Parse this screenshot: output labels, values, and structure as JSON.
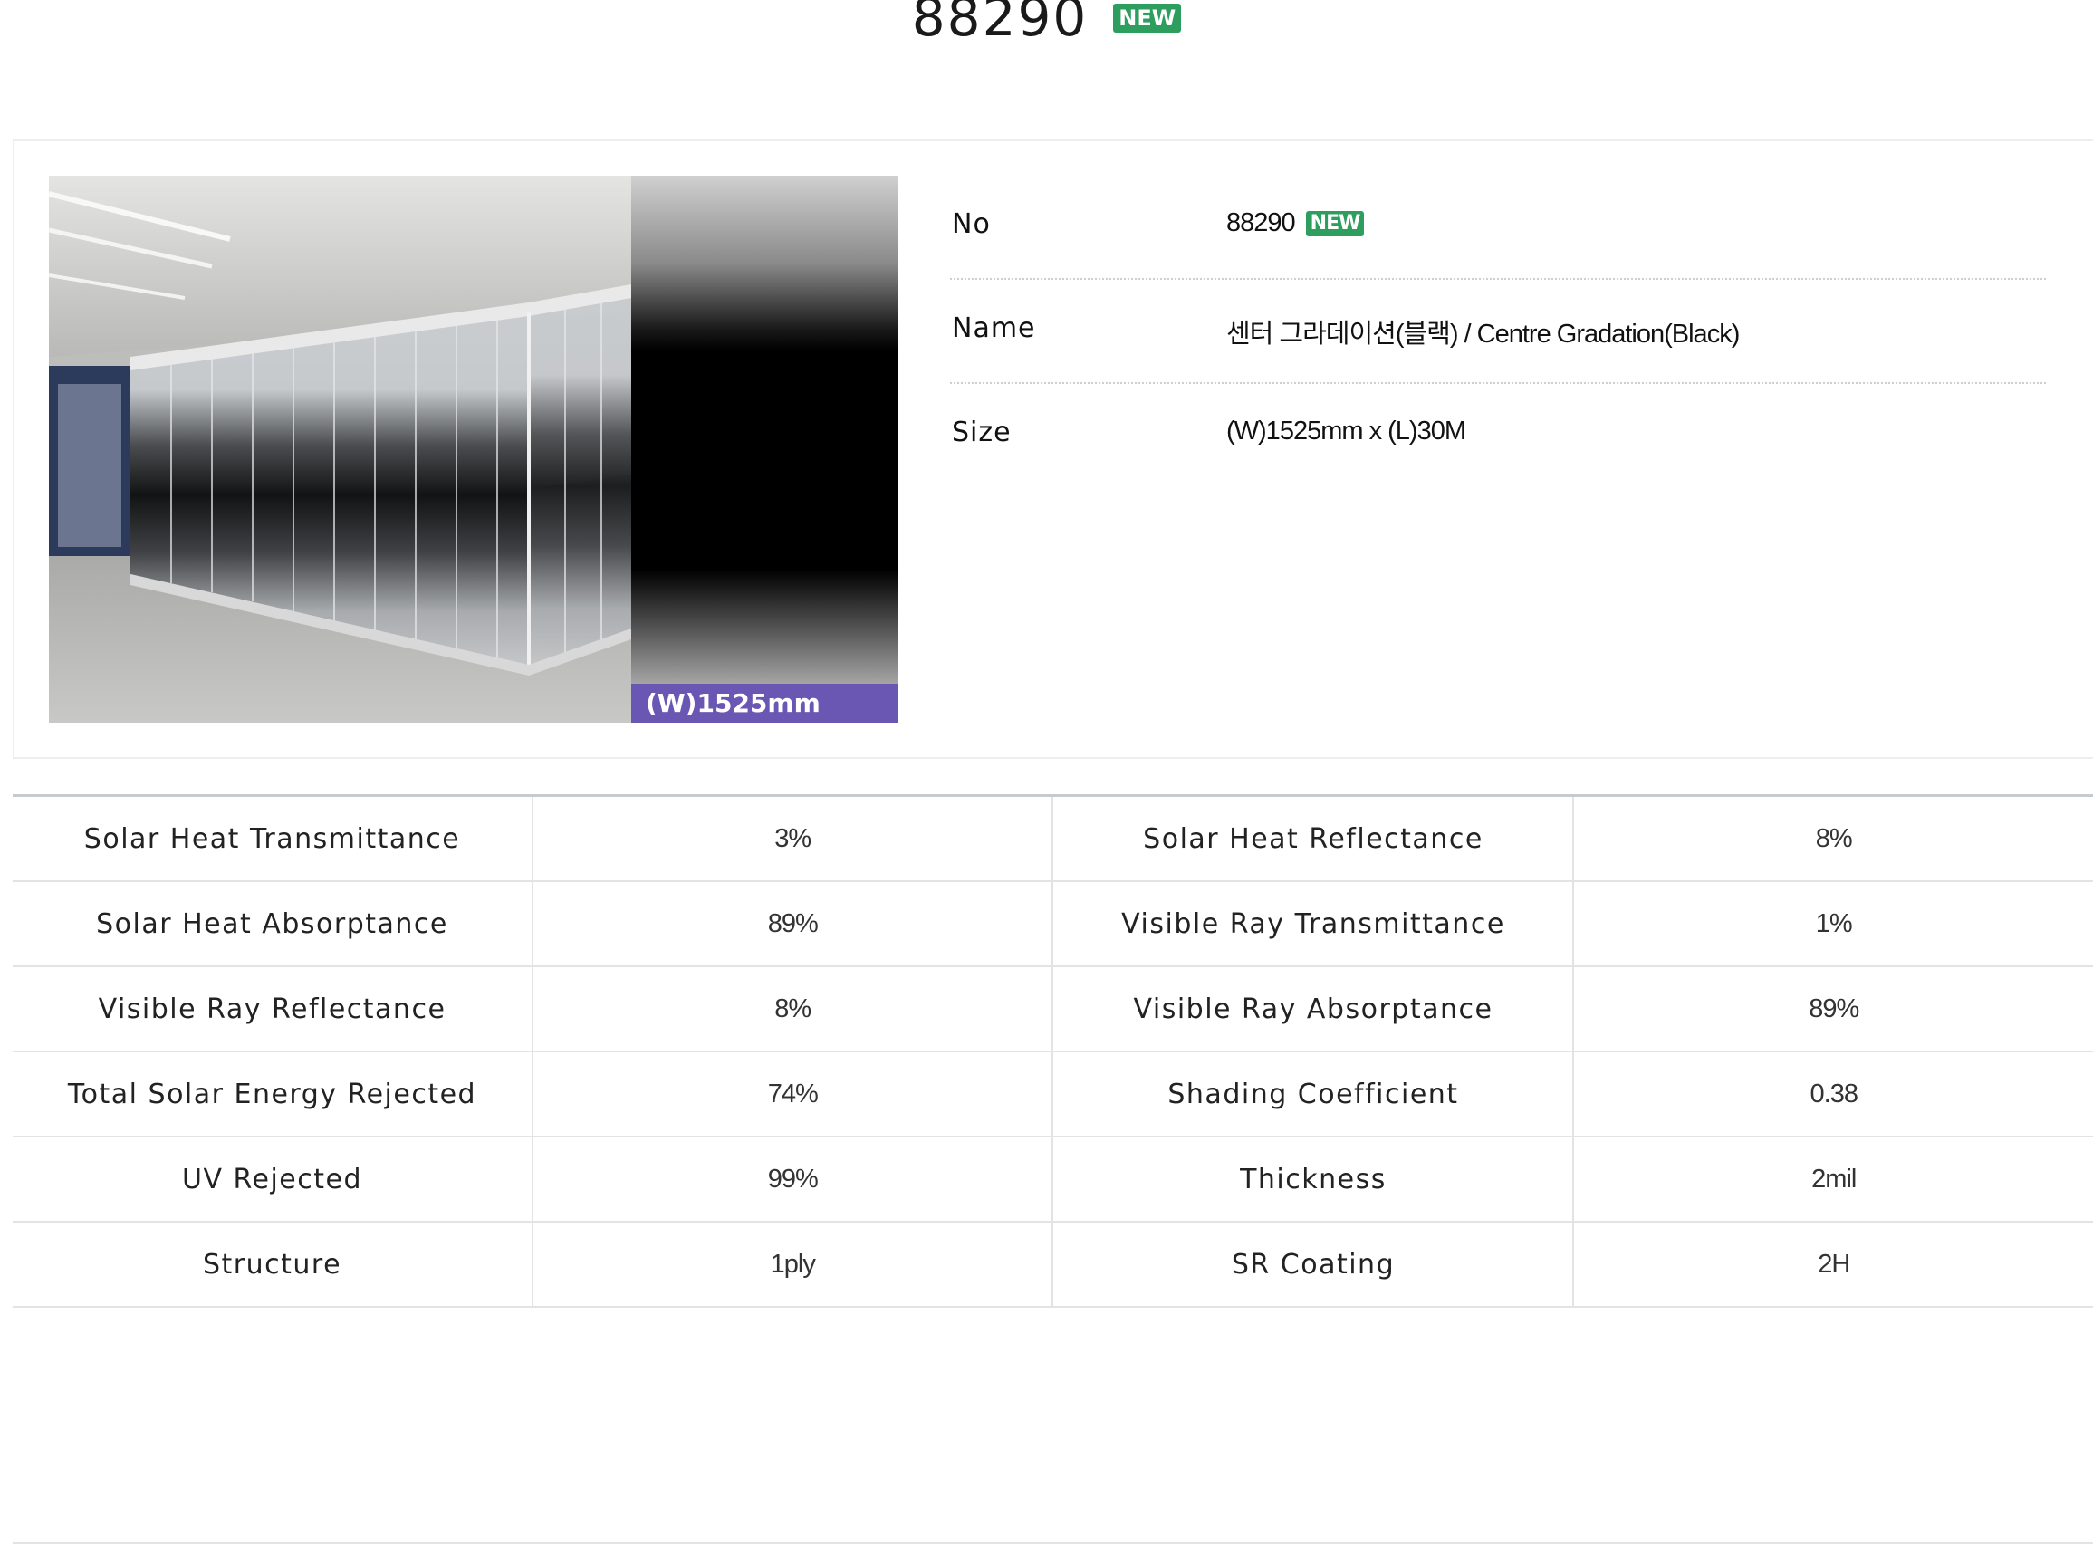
{
  "header": {
    "title": "88290",
    "badge": "NEW"
  },
  "image": {
    "size_label": "(W)1525mm"
  },
  "info": [
    {
      "label": "No",
      "value": "88290",
      "badge": "NEW"
    },
    {
      "label": "Name",
      "value": "센터 그라데이션(블랙) / Centre Gradation(Black)"
    },
    {
      "label": "Size",
      "value": "(W)1525mm x (L)30M"
    }
  ],
  "specs": [
    {
      "l1": "Solar Heat Transmittance",
      "v1": "3%",
      "l2": "Solar Heat Reflectance",
      "v2": "8%"
    },
    {
      "l1": "Solar Heat Absorptance",
      "v1": "89%",
      "l2": "Visible Ray Transmittance",
      "v2": "1%"
    },
    {
      "l1": "Visible Ray Reflectance",
      "v1": "8%",
      "l2": "Visible Ray Absorptance",
      "v2": "89%"
    },
    {
      "l1": "Total Solar Energy Rejected",
      "v1": "74%",
      "l2": "Shading Coefficient",
      "v2": "0.38"
    },
    {
      "l1": "UV Rejected",
      "v1": "99%",
      "l2": "Thickness",
      "v2": "2mil"
    },
    {
      "l1": "Structure",
      "v1": "1ply",
      "l2": "SR Coating",
      "v2": "2H"
    }
  ],
  "colors": {
    "badge": "#2e9e5e",
    "size_strip": "#6a57b4"
  }
}
